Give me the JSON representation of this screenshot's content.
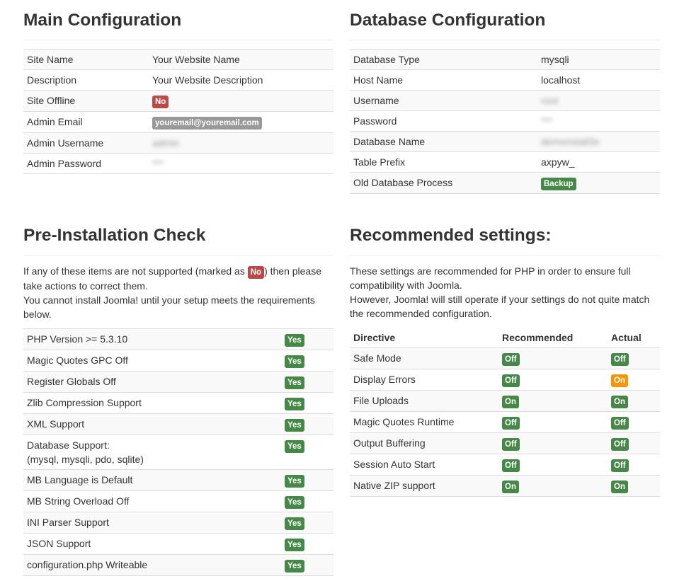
{
  "main_config": {
    "title": "Main Configuration",
    "rows": [
      {
        "label": "Site Name",
        "value": "Your Website Name"
      },
      {
        "label": "Description",
        "value": "Your Website Description"
      },
      {
        "label": "Site Offline",
        "badge": "No"
      },
      {
        "label": "Admin Email",
        "badge": "youremail@youremail.com"
      },
      {
        "label": "Admin Username",
        "value": "admin"
      },
      {
        "label": "Admin Password",
        "value": "***"
      }
    ]
  },
  "db_config": {
    "title": "Database Configuration",
    "rows": [
      {
        "label": "Database Type",
        "value": "mysqli"
      },
      {
        "label": "Host Name",
        "value": "localhost"
      },
      {
        "label": "Username",
        "value": "root"
      },
      {
        "label": "Password",
        "value": "***"
      },
      {
        "label": "Database Name",
        "value": "demonstall3x"
      },
      {
        "label": "Table Prefix",
        "value": "axpyw_"
      },
      {
        "label": "Old Database Process",
        "badge": "Backup"
      }
    ]
  },
  "preinstall": {
    "title": "Pre-Installation Check",
    "intro_1a": "If any of these items are not supported (marked as",
    "intro_badge": "No",
    "intro_1b": ") then please take actions to correct them.",
    "intro_2": "You cannot install Joomla! until your setup meets the requirements below.",
    "rows": [
      {
        "label": "PHP Version >= 5.3.10",
        "status": "Yes"
      },
      {
        "label": "Magic Quotes GPC Off",
        "status": "Yes"
      },
      {
        "label": "Register Globals Off",
        "status": "Yes"
      },
      {
        "label": "Zlib Compression Support",
        "status": "Yes"
      },
      {
        "label": "XML Support",
        "status": "Yes"
      },
      {
        "label": "Database Support:",
        "label2": "(mysql, mysqli, pdo, sqlite)",
        "status": "Yes"
      },
      {
        "label": "MB Language is Default",
        "status": "Yes"
      },
      {
        "label": "MB String Overload Off",
        "status": "Yes"
      },
      {
        "label": "INI Parser Support",
        "status": "Yes"
      },
      {
        "label": "JSON Support",
        "status": "Yes"
      },
      {
        "label": "configuration.php Writeable",
        "status": "Yes"
      }
    ]
  },
  "recommended": {
    "title": "Recommended settings:",
    "intro_1": "These settings are recommended for PHP in order to ensure full compatibility with Joomla.",
    "intro_2": "However, Joomla! will still operate if your settings do not quite match the recommended configuration.",
    "headers": [
      "Directive",
      "Recommended",
      "Actual"
    ],
    "rows": [
      {
        "directive": "Safe Mode",
        "recommended": "Off",
        "actual": "Off",
        "actual_warn": false
      },
      {
        "directive": "Display Errors",
        "recommended": "Off",
        "actual": "On",
        "actual_warn": true
      },
      {
        "directive": "File Uploads",
        "recommended": "On",
        "actual": "On",
        "actual_warn": false
      },
      {
        "directive": "Magic Quotes Runtime",
        "recommended": "Off",
        "actual": "Off",
        "actual_warn": false
      },
      {
        "directive": "Output Buffering",
        "recommended": "Off",
        "actual": "Off",
        "actual_warn": false
      },
      {
        "directive": "Session Auto Start",
        "recommended": "Off",
        "actual": "Off",
        "actual_warn": false
      },
      {
        "directive": "Native ZIP support",
        "recommended": "On",
        "actual": "On",
        "actual_warn": false
      }
    ]
  },
  "colors": {
    "success": "#468847",
    "important": "#b94a48",
    "warning": "#f89406",
    "grey": "#999999"
  }
}
